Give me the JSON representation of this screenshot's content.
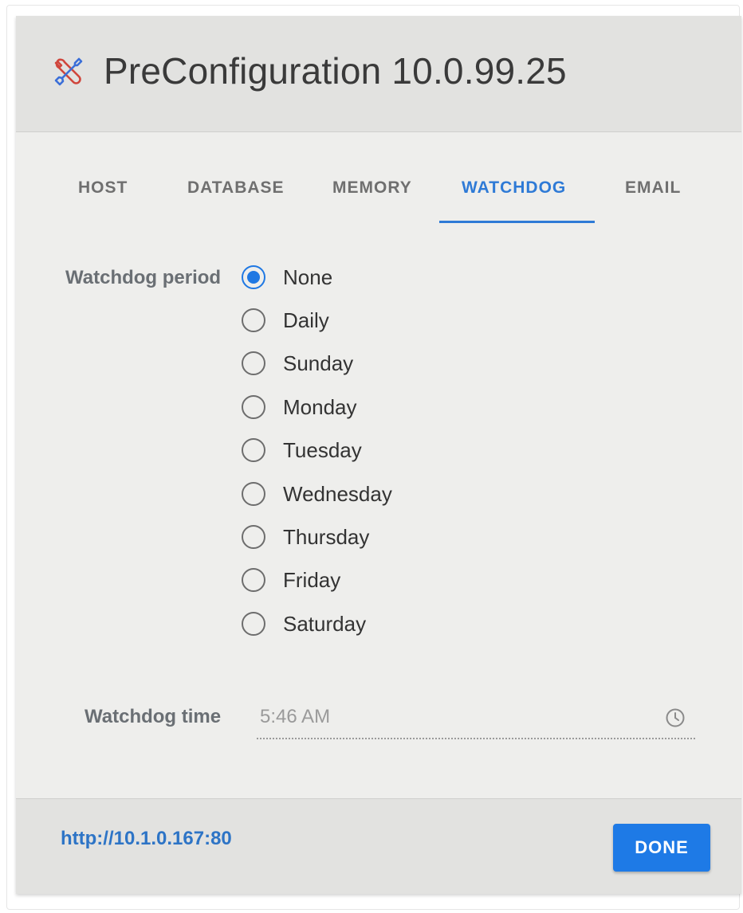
{
  "dialog": {
    "title": "PreConfiguration 10.0.99.25",
    "title_icon": "wrench-screwdriver-icon"
  },
  "tabs": [
    {
      "label": "HOST",
      "active": false
    },
    {
      "label": "DATABASE",
      "active": false
    },
    {
      "label": "MEMORY",
      "active": false
    },
    {
      "label": "WATCHDOG",
      "active": true
    },
    {
      "label": "EMAIL",
      "active": false
    }
  ],
  "watchdog": {
    "period_label": "Watchdog period",
    "period_options": [
      {
        "label": "None",
        "checked": true
      },
      {
        "label": "Daily",
        "checked": false
      },
      {
        "label": "Sunday",
        "checked": false
      },
      {
        "label": "Monday",
        "checked": false
      },
      {
        "label": "Tuesday",
        "checked": false
      },
      {
        "label": "Wednesday",
        "checked": false
      },
      {
        "label": "Thursday",
        "checked": false
      },
      {
        "label": "Friday",
        "checked": false
      },
      {
        "label": "Saturday",
        "checked": false
      }
    ],
    "time_label": "Watchdog time",
    "time_value": "5:46 AM",
    "time_icon": "clock-icon"
  },
  "footer": {
    "url": "http://10.1.0.167:80",
    "done_label": "DONE"
  },
  "colors": {
    "accent": "#1e7ae6",
    "active_tab": "#2e7ad6",
    "link": "#2d74c6"
  }
}
